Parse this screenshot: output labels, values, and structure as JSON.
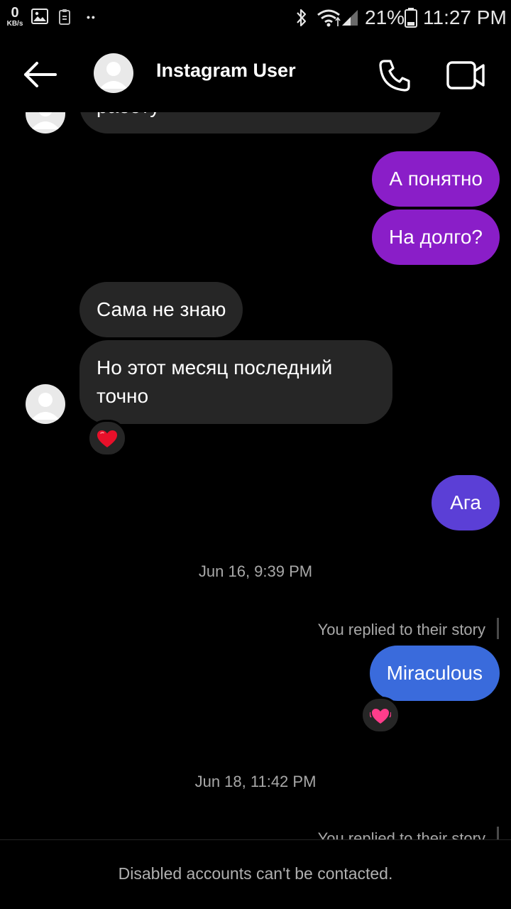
{
  "status_bar": {
    "net_speed": "0",
    "net_unit": "KB/s",
    "dots": "••",
    "battery_percent": "21%",
    "time": "11:27 PM"
  },
  "header": {
    "name": "Instagram User",
    "icons": [
      "back-arrow-icon",
      "avatar",
      "phone-icon",
      "video-camera-icon"
    ]
  },
  "messages": [
    {
      "id": "m0",
      "from": "them",
      "text": "работу"
    },
    {
      "id": "m1",
      "from": "me",
      "text": "А понятно",
      "color": "#8a1ec8"
    },
    {
      "id": "m2",
      "from": "me",
      "text": "На долго?",
      "color": "#8a1ec8"
    },
    {
      "id": "m3",
      "from": "them",
      "text": "Сама не знаю"
    },
    {
      "id": "m4",
      "from": "them",
      "lines": [
        "Но этот месяц последний",
        "точно"
      ],
      "reaction": "red-heart"
    },
    {
      "id": "m5",
      "from": "me",
      "text": "Ага",
      "color": "#5b3fd6"
    },
    {
      "id": "t1",
      "type": "timestamp",
      "text": "Jun 16, 9:39 PM"
    },
    {
      "id": "r1",
      "type": "story_reply_note",
      "text": "You replied to their story"
    },
    {
      "id": "m6",
      "from": "me",
      "text": "Miraculous",
      "color": "#3a6bdc",
      "reaction": "pink-heart"
    },
    {
      "id": "t2",
      "type": "timestamp",
      "text": "Jun 18, 11:42 PM"
    },
    {
      "id": "r2",
      "type": "story_reply_note",
      "text": "You replied to their story"
    }
  ],
  "footer": {
    "notice": "Disabled accounts can't be contacted."
  },
  "colors": {
    "background": "#000000",
    "incoming_bubble": "#262626",
    "outgoing_purple": "#8a1ec8",
    "outgoing_violet": "#5b3fd6",
    "outgoing_blue": "#3a6bdc",
    "secondary_text": "#a8a8a8"
  }
}
